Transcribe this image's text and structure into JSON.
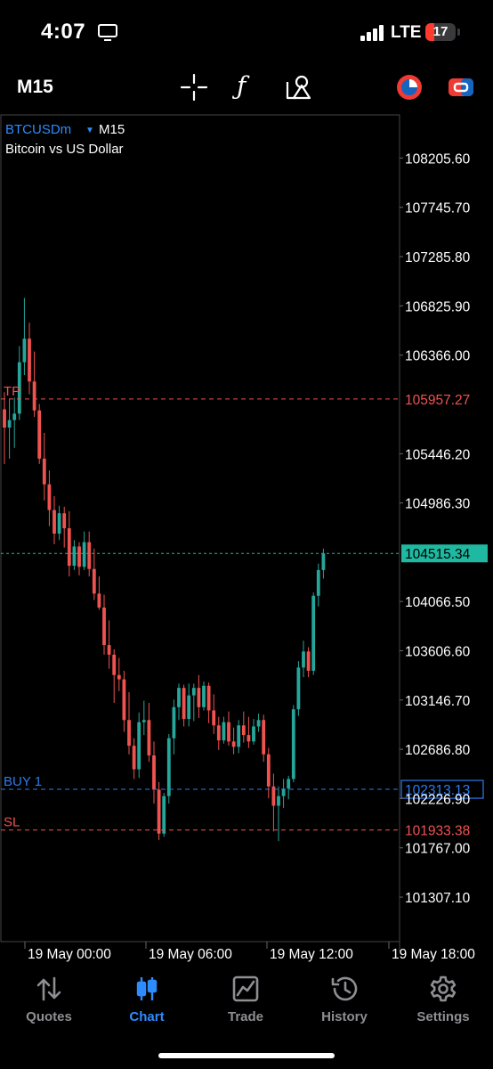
{
  "status": {
    "time": "4:07",
    "network": "LTE",
    "battery": "17"
  },
  "toolbar": {
    "timeframe": "M15"
  },
  "chart": {
    "symbol": "BTCUSDm",
    "timeframe": "M15",
    "description": "Bitcoin vs US Dollar",
    "current_price": "104515.34",
    "levels": {
      "tp": {
        "label": "TP",
        "price": "105957.27"
      },
      "buy": {
        "label": "BUY 1",
        "price": "102313.13"
      },
      "sl": {
        "label": "SL",
        "price": "101933.38"
      }
    },
    "colors": {
      "bull": "#26a69a",
      "bear": "#ef5350",
      "grid": "#3a3a3a",
      "buy": "#2d7bf0",
      "current": "#1fb8a0"
    }
  },
  "chart_data": {
    "type": "candlestick",
    "ylim": [
      100900,
      108600
    ],
    "y_ticks": [
      "108205.60",
      "107745.70",
      "107285.80",
      "106825.90",
      "106366.00",
      "105446.20",
      "104986.30",
      "104066.50",
      "103606.60",
      "103146.70",
      "102686.80",
      "102226.90",
      "101767.00",
      "101307.10"
    ],
    "x_ticks": [
      "19 May 00:00",
      "19 May 06:00",
      "19 May 12:00",
      "19 May 18:00"
    ],
    "candles": [
      [
        105860,
        106020,
        105350,
        105690
      ],
      [
        105690,
        105960,
        105400,
        105760
      ],
      [
        105760,
        105970,
        105500,
        105820
      ],
      [
        105820,
        106450,
        105760,
        106300
      ],
      [
        106300,
        106900,
        106180,
        106520
      ],
      [
        106520,
        106670,
        106000,
        106120
      ],
      [
        106120,
        106400,
        105790,
        105850
      ],
      [
        105850,
        105910,
        105350,
        105400
      ],
      [
        105400,
        105640,
        105010,
        105160
      ],
      [
        105160,
        105290,
        104770,
        104920
      ],
      [
        104920,
        105050,
        104600,
        104700
      ],
      [
        104700,
        104960,
        104640,
        104890
      ],
      [
        104890,
        104950,
        104570,
        104750
      ],
      [
        104750,
        104910,
        104300,
        104400
      ],
      [
        104400,
        104640,
        104360,
        104580
      ],
      [
        104580,
        104620,
        104310,
        104390
      ],
      [
        104390,
        104720,
        104360,
        104620
      ],
      [
        104620,
        104720,
        104300,
        104370
      ],
      [
        104370,
        104560,
        104080,
        104140
      ],
      [
        104140,
        104300,
        103990,
        104010
      ],
      [
        104010,
        104130,
        103570,
        103660
      ],
      [
        103660,
        103890,
        103440,
        103570
      ],
      [
        103570,
        103620,
        103120,
        103380
      ],
      [
        103380,
        103540,
        103230,
        103340
      ],
      [
        103340,
        103420,
        102850,
        102960
      ],
      [
        102960,
        103220,
        102640,
        102720
      ],
      [
        102720,
        102790,
        102410,
        102500
      ],
      [
        102500,
        103030,
        102420,
        102940
      ],
      [
        102940,
        103140,
        102820,
        102960
      ],
      [
        102960,
        103120,
        102570,
        102630
      ],
      [
        102630,
        102760,
        102180,
        102310
      ],
      [
        102310,
        102380,
        101840,
        101900
      ],
      [
        101900,
        102280,
        101870,
        102250
      ],
      [
        102250,
        102830,
        102180,
        102790
      ],
      [
        102790,
        103150,
        102640,
        103080
      ],
      [
        103080,
        103300,
        102960,
        103260
      ],
      [
        103260,
        103290,
        102900,
        102970
      ],
      [
        102970,
        103300,
        102900,
        103190
      ],
      [
        103190,
        103300,
        102950,
        103260
      ],
      [
        103260,
        103380,
        102980,
        103080
      ],
      [
        103080,
        103320,
        103050,
        103280
      ],
      [
        103280,
        103310,
        102930,
        103050
      ],
      [
        103050,
        103200,
        102830,
        102910
      ],
      [
        102910,
        102990,
        102680,
        102770
      ],
      [
        102770,
        102990,
        102740,
        102940
      ],
      [
        102940,
        103040,
        102720,
        102760
      ],
      [
        102760,
        102890,
        102640,
        102710
      ],
      [
        102710,
        102960,
        102650,
        102910
      ],
      [
        102910,
        103040,
        102750,
        102820
      ],
      [
        102820,
        102990,
        102700,
        102760
      ],
      [
        102760,
        102970,
        102730,
        102900
      ],
      [
        102900,
        103020,
        102850,
        102960
      ],
      [
        102960,
        103010,
        102570,
        102640
      ],
      [
        102640,
        102700,
        102230,
        102340
      ],
      [
        102340,
        102460,
        101920,
        102160
      ],
      [
        102160,
        102340,
        101830,
        102250
      ],
      [
        102250,
        102410,
        102140,
        102320
      ],
      [
        102320,
        102440,
        102220,
        102410
      ],
      [
        102410,
        103100,
        102380,
        103060
      ],
      [
        103060,
        103510,
        103000,
        103450
      ],
      [
        103450,
        103700,
        103360,
        103600
      ],
      [
        103600,
        103640,
        103360,
        103420
      ],
      [
        103420,
        104150,
        103380,
        104120
      ],
      [
        104120,
        104420,
        104020,
        104360
      ],
      [
        104360,
        104560,
        104280,
        104515.34
      ]
    ]
  },
  "tabs": [
    {
      "label": "Quotes"
    },
    {
      "label": "Chart"
    },
    {
      "label": "Trade"
    },
    {
      "label": "History"
    },
    {
      "label": "Settings"
    }
  ]
}
